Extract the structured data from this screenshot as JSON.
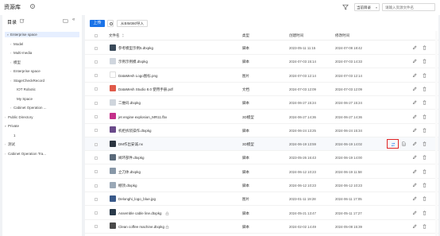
{
  "header": {
    "title": "资源库",
    "scope_value": "当前目录",
    "search_placeholder": "请输入资源文件名"
  },
  "sidebar": {
    "title": "目录",
    "items": [
      {
        "label": "Enterprise space",
        "arrow": "▾",
        "selected": true
      },
      {
        "label": "Model",
        "arrow": "›"
      },
      {
        "label": "Multi-media",
        "arrow": "›"
      },
      {
        "label": "模型",
        "arrow": "›"
      },
      {
        "label": "Enterprise space",
        "arrow": "›"
      },
      {
        "label": "StageCheckRecord",
        "arrow": "›"
      },
      {
        "label": "IOT Robotic",
        "arrow": ""
      },
      {
        "label": "My Space",
        "arrow": ""
      },
      {
        "label": "Cabinet Operation ...",
        "arrow": "›"
      },
      {
        "label": "Public Directory",
        "arrow": "›"
      },
      {
        "label": "Private",
        "arrow": "▾"
      },
      {
        "label": "1",
        "arrow": ""
      },
      {
        "label": "测试",
        "arrow": "›"
      },
      {
        "label": "Cabinet Operation Tra...",
        "arrow": "›"
      }
    ]
  },
  "toolbar": {
    "upload_label": "上传",
    "import_label": "从BIM360导入"
  },
  "table": {
    "columns": {
      "name": "文件名",
      "type": "类型",
      "created": "创建时间",
      "modified": "修改时间"
    },
    "rows": [
      {
        "name": "参考模型示例5.dtxpkg",
        "type": "脚本",
        "created": "2023-05-11 11:15",
        "modified": "2024-07-08 18:42",
        "thumb": "#3a4a5a",
        "lock": false
      },
      {
        "name": "示例示例模.dtxpkg",
        "type": "脚本",
        "created": "2024-07-03 15:14",
        "modified": "2024-07-03 14:33",
        "thumb": "#d0d6de",
        "lock": false
      },
      {
        "name": "DataMesh Logo图标.png",
        "type": "图片",
        "created": "2024-07-03 12:14",
        "modified": "2024-07-03 12:14",
        "thumb": "#ffffff",
        "lock": false
      },
      {
        "name": "DataMesh Studio 8.0 使用手册.pdf",
        "type": "文档",
        "created": "2024-07-03 12:09",
        "modified": "2024-07-03 12:09",
        "thumb": "#e05a4a",
        "lock": false
      },
      {
        "name": "二维码.dtxpkg",
        "type": "脚本",
        "created": "2024-06-27 15:24",
        "modified": "2024-06-27 15:24",
        "thumb": "#cfd5dc",
        "lock": false
      },
      {
        "name": "jet engine explosion_MR11.fbx",
        "type": "3D模型",
        "created": "2024-06-27 14:36",
        "modified": "2024-06-27 14:36",
        "thumb": "#c4308a",
        "lock": false
      },
      {
        "name": "机柜拆装操作.dtxpkg",
        "type": "脚本",
        "created": "2024-06-24 13:25",
        "modified": "2024-06-24 15:34",
        "thumb": "#6a4a8a",
        "lock": false
      },
      {
        "name": "DM作出安诚.nx",
        "type": "3D模型",
        "created": "2024-06-19 13:59",
        "modified": "2024-06-19 14:02",
        "thumb": "#2a3440",
        "lock": false
      },
      {
        "name": "阀环部件.dtxpkg",
        "type": "脚本",
        "created": "2023-05-26 16:43",
        "modified": "2024-06-19 14:00",
        "thumb": "#5a6a7a",
        "lock": false
      },
      {
        "name": "立刀体.dtxpkg",
        "type": "脚本",
        "created": "2024-06-12 10:23",
        "modified": "2024-06-19 11:58",
        "thumb": "#8898a8",
        "lock": false
      },
      {
        "name": "棚顶.dtxpkg",
        "type": "脚本",
        "created": "2024-06-12 10:23",
        "modified": "2024-06-12 10:23",
        "thumb": "#9aa8b6",
        "lock": false
      },
      {
        "name": "Delonghi_logo_blue.jpg",
        "type": "图片",
        "created": "2023-01-11 19:28",
        "modified": "2024-06-11 17:05",
        "thumb": "#3a5a8a",
        "lock": false
      },
      {
        "name": "Assemble cable line.dtxpkg",
        "type": "脚本",
        "created": "2024-05-21 13:47",
        "modified": "2024-05-11 17:27",
        "thumb": "#2a3a4a",
        "lock": true
      },
      {
        "name": "Clean coffee machine.dtxpkg",
        "type": "脚本",
        "created": "2024-02-02 14:49",
        "modified": "2024-05-08 15:39",
        "thumb": "#4a4a4a",
        "lock": true
      }
    ]
  },
  "icons": {
    "help": "help-circle-icon",
    "filter": "filter-icon",
    "edit": "pencil-icon",
    "delete": "trash-icon",
    "replace": "swap-icon",
    "document": "document-icon",
    "lock": "lock-icon"
  },
  "colors": {
    "primary": "#1a73e8",
    "highlight_border": "#e02424",
    "selected_bg": "#e6efff"
  }
}
